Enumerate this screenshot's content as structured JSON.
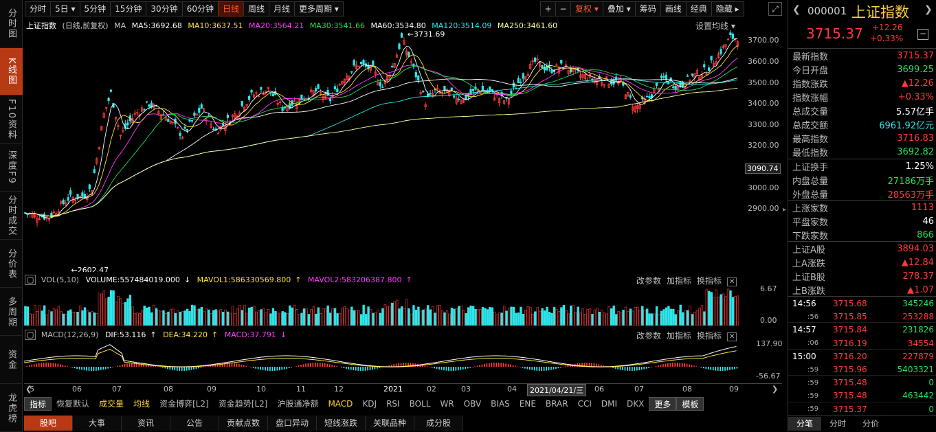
{
  "left_nav": [
    "分时图",
    "K线图",
    "F10资料",
    "深度F9",
    "分时成交",
    "分价表",
    "多周期",
    "资金",
    "龙虎榜"
  ],
  "left_nav_active": 1,
  "period_tabs": [
    "分时",
    "5日 ▾",
    "5分钟",
    "15分钟",
    "30分钟",
    "60分钟",
    "日线",
    "周线",
    "月线",
    "更多周期 ▾"
  ],
  "period_active": 6,
  "tools": [
    "+",
    "−",
    "复权 ▾",
    "叠加 ▾",
    "筹码",
    "画线",
    "经典",
    "隐藏 ▸"
  ],
  "info": {
    "name": "上证指数",
    "mode": "(日线,前复权)",
    "ma": "MA",
    "ma5": "MA5:3692.68",
    "ma10": "MA10:3637.51",
    "ma20": "MA20:3564.21",
    "ma30": "MA30:3541.66",
    "ma60": "MA60:3534.80",
    "ma120": "MA120:3514.09",
    "ma250": "MA250:3461.60",
    "settings": "设置均线 ▾"
  },
  "price_axis": [
    "3700.00",
    "3600.00",
    "3500.00",
    "3400.00",
    "3300.00",
    "3200.00",
    "3100.00",
    "3000.00",
    "2900.00"
  ],
  "current_price_tag": "3090.74",
  "max_label": "3731.69",
  "min_label": "2602.47",
  "vol": {
    "title": "VOL(5,10)",
    "volume": "VOLUME:557484019.000",
    "mavol1": "MAVOL1:586330569.800",
    "mavol2": "MAVOL2:583206387.800",
    "axis_top": "6.67",
    "axis_bot": "0.00"
  },
  "macd": {
    "title": "MACD(12,26,9)",
    "dif": "DIF:53.116",
    "dea": "DEA:34.220",
    "macd": "MACD:37.791",
    "axis_top": "137.90",
    "axis_bot": "-56.67"
  },
  "sub_tools": [
    "改参数",
    "加指标",
    "换指标"
  ],
  "time_axis": [
    "5",
    "06",
    "07",
    "08",
    "09",
    "10",
    "11",
    "12",
    "2021",
    "02",
    "03",
    "04",
    "05",
    "06",
    "07",
    "08",
    "09"
  ],
  "cursor_date": "2021/04/21/三",
  "indicator_tabs": [
    "指标",
    "恢复默认",
    "成交量",
    "均线",
    "资金博弈[L2]",
    "资金趋势[L2]",
    "沪股通净额",
    "MACD",
    "KDJ",
    "RSI",
    "BOLL",
    "WR",
    "OBV",
    "BIAS",
    "ENE",
    "BRAR",
    "CCI",
    "DMI",
    "DKX",
    "更多",
    "模板"
  ],
  "bottom_tabs": [
    "股吧",
    "大事",
    "资讯",
    "公告",
    "贡献点数",
    "盘口异动",
    "短线涨跌",
    "关联品种",
    "成分股"
  ],
  "stock": {
    "code": "000001",
    "name": "上证指数",
    "price": "3715.37",
    "chg": "+12.26",
    "pct": "+0.33%"
  },
  "quote": [
    {
      "k": "最新指数",
      "v": "3715.37",
      "c": "red"
    },
    {
      "k": "今日开盘",
      "v": "3699.25",
      "c": "grn"
    },
    {
      "k": "指数涨跌",
      "v": "▲12.26",
      "c": "red"
    },
    {
      "k": "指数涨幅",
      "v": "+0.33%",
      "c": "red"
    },
    {
      "k": "总成交量",
      "v": "5.57亿手",
      "c": "wht"
    },
    {
      "k": "总成交额",
      "v": "6961.92亿元",
      "c": "cyn"
    },
    {
      "k": "最高指数",
      "v": "3716.83",
      "c": "red"
    },
    {
      "k": "最低指数",
      "v": "3692.82",
      "c": "grn"
    }
  ],
  "quote2": [
    {
      "k": "上证换手",
      "v": "1.25%",
      "c": "wht"
    },
    {
      "k": "内盘总量",
      "v": "27186万手",
      "c": "grn"
    },
    {
      "k": "外盘总量",
      "v": "28563万手",
      "c": "red"
    }
  ],
  "quote3": [
    {
      "k": "上涨家数",
      "v": "1113",
      "c": "red"
    },
    {
      "k": "平盘家数",
      "v": "46",
      "c": "wht"
    },
    {
      "k": "下跌家数",
      "v": "866",
      "c": "grn"
    }
  ],
  "quote4": [
    {
      "k": "上证A股",
      "v": "3894.03",
      "c": "red"
    },
    {
      "k": "上A涨跌",
      "v": "▲12.84",
      "c": "red"
    },
    {
      "k": "上证B股",
      "v": "278.37",
      "c": "red"
    },
    {
      "k": "上B涨跌",
      "v": "▲1.07",
      "c": "red"
    }
  ],
  "ticks": [
    {
      "t": "14:56",
      "p": "3715.68",
      "v": "345246",
      "vc": "grn"
    },
    {
      "t": ":56",
      "p": "3715.85",
      "v": "253288",
      "vc": "red"
    },
    {
      "t": "14:57",
      "p": "3715.84",
      "v": "231826",
      "vc": "grn"
    },
    {
      "t": ":06",
      "p": "3716.19",
      "v": "34554",
      "vc": "red"
    },
    {
      "t": "15:00",
      "p": "3716.20",
      "v": "227879",
      "vc": "red"
    },
    {
      "t": ":59",
      "p": "3715.96",
      "v": "5403321",
      "vc": "grn"
    },
    {
      "t": ":59",
      "p": "3715.48",
      "v": "0",
      "vc": "grn"
    },
    {
      "t": ":59",
      "p": "3715.48",
      "v": "463442",
      "vc": "grn"
    },
    {
      "t": ":59",
      "p": "3715.37",
      "v": "0",
      "vc": "grn"
    }
  ],
  "rp_tabs": [
    "分笔",
    "分时",
    "分价"
  ],
  "chart_data": {
    "type": "candlestick",
    "series": [
      {
        "name": "MA5",
        "color": "#ffffff"
      },
      {
        "name": "MA10",
        "color": "#ffe23a"
      },
      {
        "name": "MA20",
        "color": "#ff3aff"
      },
      {
        "name": "MA30",
        "color": "#22e05a"
      },
      {
        "name": "MA60",
        "color": "#ffffff"
      },
      {
        "name": "MA120",
        "color": "#2ee6ea"
      },
      {
        "name": "MA250",
        "color": "#ffffa0"
      }
    ],
    "ylim": [
      2600,
      3750
    ],
    "anchors": [
      [
        0,
        2880
      ],
      [
        10,
        2860
      ],
      [
        18,
        2950
      ],
      [
        24,
        2960
      ],
      [
        28,
        3000
      ],
      [
        33,
        3350
      ],
      [
        36,
        3450
      ],
      [
        40,
        3250
      ],
      [
        46,
        3350
      ],
      [
        52,
        3400
      ],
      [
        60,
        3330
      ],
      [
        66,
        3250
      ],
      [
        74,
        3380
      ],
      [
        80,
        3270
      ],
      [
        88,
        3350
      ],
      [
        95,
        3440
      ],
      [
        102,
        3470
      ],
      [
        108,
        3380
      ],
      [
        115,
        3420
      ],
      [
        122,
        3460
      ],
      [
        128,
        3420
      ],
      [
        134,
        3530
      ],
      [
        140,
        3590
      ],
      [
        146,
        3560
      ],
      [
        150,
        3480
      ],
      [
        155,
        3600
      ],
      [
        158,
        3710
      ],
      [
        162,
        3600
      ],
      [
        168,
        3410
      ],
      [
        172,
        3460
      ],
      [
        178,
        3450
      ],
      [
        184,
        3420
      ],
      [
        190,
        3470
      ],
      [
        196,
        3450
      ],
      [
        202,
        3410
      ],
      [
        208,
        3520
      ],
      [
        214,
        3600
      ],
      [
        220,
        3560
      ],
      [
        226,
        3580
      ],
      [
        232,
        3540
      ],
      [
        238,
        3520
      ],
      [
        244,
        3510
      ],
      [
        250,
        3500
      ],
      [
        256,
        3380
      ],
      [
        262,
        3430
      ],
      [
        268,
        3520
      ],
      [
        274,
        3480
      ],
      [
        280,
        3530
      ],
      [
        286,
        3560
      ],
      [
        292,
        3650
      ],
      [
        296,
        3715
      ]
    ]
  }
}
